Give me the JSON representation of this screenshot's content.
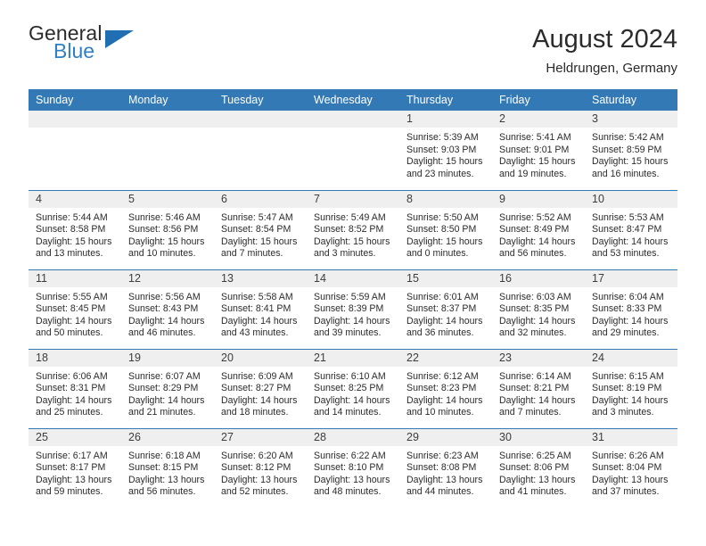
{
  "brand": {
    "name_top": "General",
    "name_bottom": "Blue",
    "accent_color": "#2f7fc4",
    "triangle_color": "#1f6fb2"
  },
  "header": {
    "title": "August 2024",
    "subtitle": "Heldrungen, Germany",
    "header_bg": "#3379b5",
    "daynum_bg": "#efefef"
  },
  "weekdays": [
    "Sunday",
    "Monday",
    "Tuesday",
    "Wednesday",
    "Thursday",
    "Friday",
    "Saturday"
  ],
  "labels": {
    "sunrise": "Sunrise:",
    "sunset": "Sunset:",
    "daylight": "Daylight:"
  },
  "weeks": [
    [
      {
        "day": "",
        "blank": true,
        "sunrise": "",
        "sunset": "",
        "daylight_line1": "",
        "daylight_line2": ""
      },
      {
        "day": "",
        "blank": true,
        "sunrise": "",
        "sunset": "",
        "daylight_line1": "",
        "daylight_line2": ""
      },
      {
        "day": "",
        "blank": true,
        "sunrise": "",
        "sunset": "",
        "daylight_line1": "",
        "daylight_line2": ""
      },
      {
        "day": "",
        "blank": true,
        "sunrise": "",
        "sunset": "",
        "daylight_line1": "",
        "daylight_line2": ""
      },
      {
        "day": "1",
        "blank": false,
        "sunrise": "Sunrise: 5:39 AM",
        "sunset": "Sunset: 9:03 PM",
        "daylight_line1": "Daylight: 15 hours",
        "daylight_line2": "and 23 minutes."
      },
      {
        "day": "2",
        "blank": false,
        "sunrise": "Sunrise: 5:41 AM",
        "sunset": "Sunset: 9:01 PM",
        "daylight_line1": "Daylight: 15 hours",
        "daylight_line2": "and 19 minutes."
      },
      {
        "day": "3",
        "blank": false,
        "sunrise": "Sunrise: 5:42 AM",
        "sunset": "Sunset: 8:59 PM",
        "daylight_line1": "Daylight: 15 hours",
        "daylight_line2": "and 16 minutes."
      }
    ],
    [
      {
        "day": "4",
        "blank": false,
        "sunrise": "Sunrise: 5:44 AM",
        "sunset": "Sunset: 8:58 PM",
        "daylight_line1": "Daylight: 15 hours",
        "daylight_line2": "and 13 minutes."
      },
      {
        "day": "5",
        "blank": false,
        "sunrise": "Sunrise: 5:46 AM",
        "sunset": "Sunset: 8:56 PM",
        "daylight_line1": "Daylight: 15 hours",
        "daylight_line2": "and 10 minutes."
      },
      {
        "day": "6",
        "blank": false,
        "sunrise": "Sunrise: 5:47 AM",
        "sunset": "Sunset: 8:54 PM",
        "daylight_line1": "Daylight: 15 hours",
        "daylight_line2": "and 7 minutes."
      },
      {
        "day": "7",
        "blank": false,
        "sunrise": "Sunrise: 5:49 AM",
        "sunset": "Sunset: 8:52 PM",
        "daylight_line1": "Daylight: 15 hours",
        "daylight_line2": "and 3 minutes."
      },
      {
        "day": "8",
        "blank": false,
        "sunrise": "Sunrise: 5:50 AM",
        "sunset": "Sunset: 8:50 PM",
        "daylight_line1": "Daylight: 15 hours",
        "daylight_line2": "and 0 minutes."
      },
      {
        "day": "9",
        "blank": false,
        "sunrise": "Sunrise: 5:52 AM",
        "sunset": "Sunset: 8:49 PM",
        "daylight_line1": "Daylight: 14 hours",
        "daylight_line2": "and 56 minutes."
      },
      {
        "day": "10",
        "blank": false,
        "sunrise": "Sunrise: 5:53 AM",
        "sunset": "Sunset: 8:47 PM",
        "daylight_line1": "Daylight: 14 hours",
        "daylight_line2": "and 53 minutes."
      }
    ],
    [
      {
        "day": "11",
        "blank": false,
        "sunrise": "Sunrise: 5:55 AM",
        "sunset": "Sunset: 8:45 PM",
        "daylight_line1": "Daylight: 14 hours",
        "daylight_line2": "and 50 minutes."
      },
      {
        "day": "12",
        "blank": false,
        "sunrise": "Sunrise: 5:56 AM",
        "sunset": "Sunset: 8:43 PM",
        "daylight_line1": "Daylight: 14 hours",
        "daylight_line2": "and 46 minutes."
      },
      {
        "day": "13",
        "blank": false,
        "sunrise": "Sunrise: 5:58 AM",
        "sunset": "Sunset: 8:41 PM",
        "daylight_line1": "Daylight: 14 hours",
        "daylight_line2": "and 43 minutes."
      },
      {
        "day": "14",
        "blank": false,
        "sunrise": "Sunrise: 5:59 AM",
        "sunset": "Sunset: 8:39 PM",
        "daylight_line1": "Daylight: 14 hours",
        "daylight_line2": "and 39 minutes."
      },
      {
        "day": "15",
        "blank": false,
        "sunrise": "Sunrise: 6:01 AM",
        "sunset": "Sunset: 8:37 PM",
        "daylight_line1": "Daylight: 14 hours",
        "daylight_line2": "and 36 minutes."
      },
      {
        "day": "16",
        "blank": false,
        "sunrise": "Sunrise: 6:03 AM",
        "sunset": "Sunset: 8:35 PM",
        "daylight_line1": "Daylight: 14 hours",
        "daylight_line2": "and 32 minutes."
      },
      {
        "day": "17",
        "blank": false,
        "sunrise": "Sunrise: 6:04 AM",
        "sunset": "Sunset: 8:33 PM",
        "daylight_line1": "Daylight: 14 hours",
        "daylight_line2": "and 29 minutes."
      }
    ],
    [
      {
        "day": "18",
        "blank": false,
        "sunrise": "Sunrise: 6:06 AM",
        "sunset": "Sunset: 8:31 PM",
        "daylight_line1": "Daylight: 14 hours",
        "daylight_line2": "and 25 minutes."
      },
      {
        "day": "19",
        "blank": false,
        "sunrise": "Sunrise: 6:07 AM",
        "sunset": "Sunset: 8:29 PM",
        "daylight_line1": "Daylight: 14 hours",
        "daylight_line2": "and 21 minutes."
      },
      {
        "day": "20",
        "blank": false,
        "sunrise": "Sunrise: 6:09 AM",
        "sunset": "Sunset: 8:27 PM",
        "daylight_line1": "Daylight: 14 hours",
        "daylight_line2": "and 18 minutes."
      },
      {
        "day": "21",
        "blank": false,
        "sunrise": "Sunrise: 6:10 AM",
        "sunset": "Sunset: 8:25 PM",
        "daylight_line1": "Daylight: 14 hours",
        "daylight_line2": "and 14 minutes."
      },
      {
        "day": "22",
        "blank": false,
        "sunrise": "Sunrise: 6:12 AM",
        "sunset": "Sunset: 8:23 PM",
        "daylight_line1": "Daylight: 14 hours",
        "daylight_line2": "and 10 minutes."
      },
      {
        "day": "23",
        "blank": false,
        "sunrise": "Sunrise: 6:14 AM",
        "sunset": "Sunset: 8:21 PM",
        "daylight_line1": "Daylight: 14 hours",
        "daylight_line2": "and 7 minutes."
      },
      {
        "day": "24",
        "blank": false,
        "sunrise": "Sunrise: 6:15 AM",
        "sunset": "Sunset: 8:19 PM",
        "daylight_line1": "Daylight: 14 hours",
        "daylight_line2": "and 3 minutes."
      }
    ],
    [
      {
        "day": "25",
        "blank": false,
        "sunrise": "Sunrise: 6:17 AM",
        "sunset": "Sunset: 8:17 PM",
        "daylight_line1": "Daylight: 13 hours",
        "daylight_line2": "and 59 minutes."
      },
      {
        "day": "26",
        "blank": false,
        "sunrise": "Sunrise: 6:18 AM",
        "sunset": "Sunset: 8:15 PM",
        "daylight_line1": "Daylight: 13 hours",
        "daylight_line2": "and 56 minutes."
      },
      {
        "day": "27",
        "blank": false,
        "sunrise": "Sunrise: 6:20 AM",
        "sunset": "Sunset: 8:12 PM",
        "daylight_line1": "Daylight: 13 hours",
        "daylight_line2": "and 52 minutes."
      },
      {
        "day": "28",
        "blank": false,
        "sunrise": "Sunrise: 6:22 AM",
        "sunset": "Sunset: 8:10 PM",
        "daylight_line1": "Daylight: 13 hours",
        "daylight_line2": "and 48 minutes."
      },
      {
        "day": "29",
        "blank": false,
        "sunrise": "Sunrise: 6:23 AM",
        "sunset": "Sunset: 8:08 PM",
        "daylight_line1": "Daylight: 13 hours",
        "daylight_line2": "and 44 minutes."
      },
      {
        "day": "30",
        "blank": false,
        "sunrise": "Sunrise: 6:25 AM",
        "sunset": "Sunset: 8:06 PM",
        "daylight_line1": "Daylight: 13 hours",
        "daylight_line2": "and 41 minutes."
      },
      {
        "day": "31",
        "blank": false,
        "sunrise": "Sunrise: 6:26 AM",
        "sunset": "Sunset: 8:04 PM",
        "daylight_line1": "Daylight: 13 hours",
        "daylight_line2": "and 37 minutes."
      }
    ]
  ]
}
